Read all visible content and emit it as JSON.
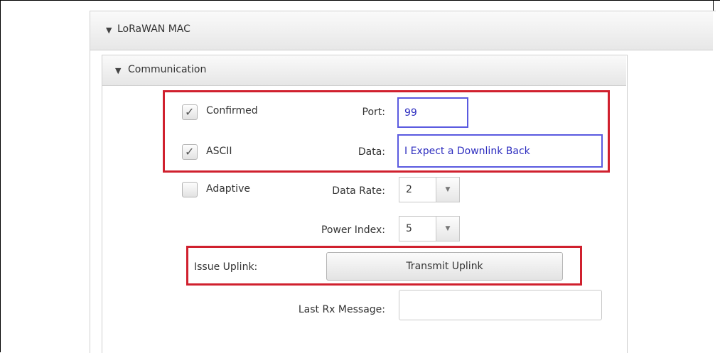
{
  "outer_section": {
    "title": "LoRaWAN MAC",
    "toggle_icon": "triangle-down-icon"
  },
  "inner_section": {
    "title": "Communication",
    "toggle_icon": "triangle-down-icon"
  },
  "options": {
    "confirmed": {
      "label": "Confirmed",
      "checked": true
    },
    "ascii": {
      "label": "ASCII",
      "checked": true
    },
    "adaptive": {
      "label": "Adaptive",
      "checked": false
    }
  },
  "fields": {
    "port": {
      "label": "Port:",
      "value": "99"
    },
    "data": {
      "label": "Data:",
      "value": "I Expect a Downlink Back"
    },
    "data_rate": {
      "label": "Data Rate:",
      "value": "2"
    },
    "power_index": {
      "label": "Power Index:",
      "value": "5"
    },
    "last_rx": {
      "label": "Last Rx Message:",
      "value": ""
    }
  },
  "uplink": {
    "label": "Issue Uplink:",
    "button_label": "Transmit Uplink"
  },
  "colors": {
    "highlight_border": "#d0202e",
    "field_focus": "#5a5ae0"
  }
}
